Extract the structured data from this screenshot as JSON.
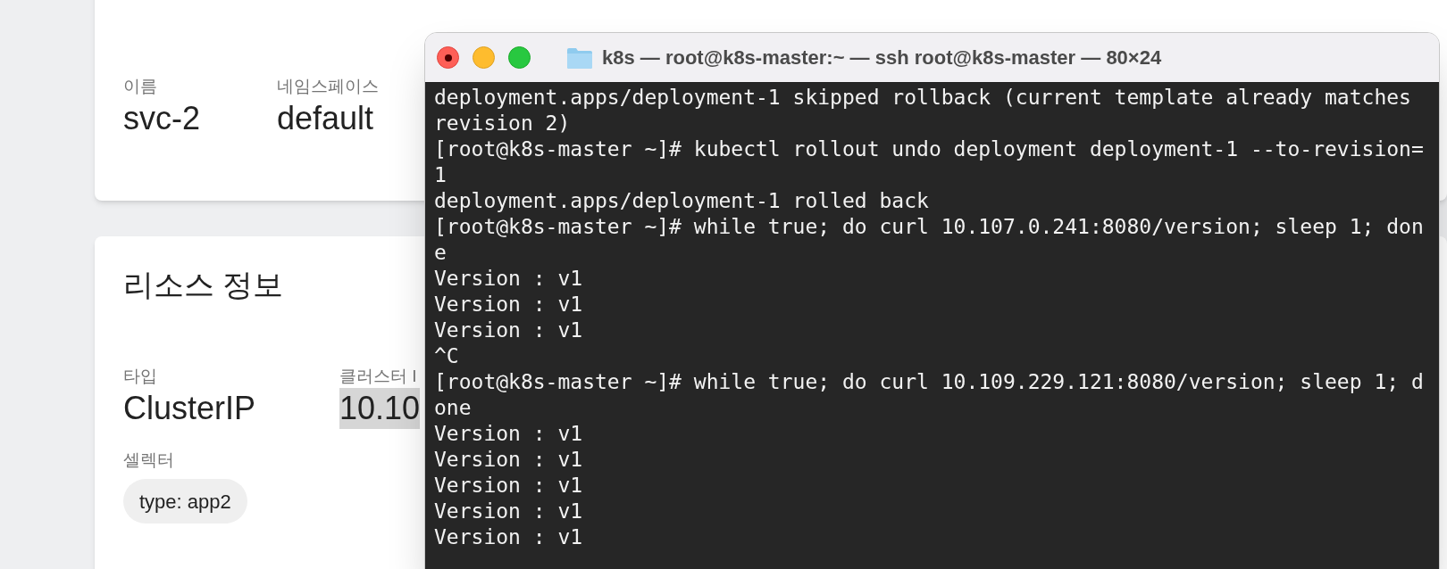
{
  "service_card": {
    "fields": [
      {
        "label": "이름",
        "value": "svc-2"
      },
      {
        "label": "네임스페이스",
        "value": "default"
      }
    ]
  },
  "resource_card": {
    "title": "리소스 정보",
    "fields": [
      {
        "label": "타입",
        "value": "ClusterIP",
        "highlighted": false
      },
      {
        "label": "클러스터 I",
        "value": "10.10",
        "highlighted": true
      }
    ],
    "selector": {
      "label": "셀렉터",
      "tags": [
        "type: app2"
      ]
    }
  },
  "terminal": {
    "title": "k8s — root@k8s-master:~ — ssh root@k8s-master — 80×24",
    "lines": [
      "deployment.apps/deployment-1 skipped rollback (current template already matches",
      "revision 2)",
      "[root@k8s-master ~]# kubectl rollout undo deployment deployment-1 --to-revision=",
      "1",
      "deployment.apps/deployment-1 rolled back",
      "[root@k8s-master ~]# while true; do curl 10.107.0.241:8080/version; sleep 1; don",
      "e",
      "Version : v1",
      "Version : v1",
      "Version : v1",
      "^C",
      "[root@k8s-master ~]# while true; do curl 10.109.229.121:8080/version; sleep 1; d",
      "one",
      "Version : v1",
      "Version : v1",
      "Version : v1",
      "Version : v1",
      "Version : v1"
    ]
  }
}
